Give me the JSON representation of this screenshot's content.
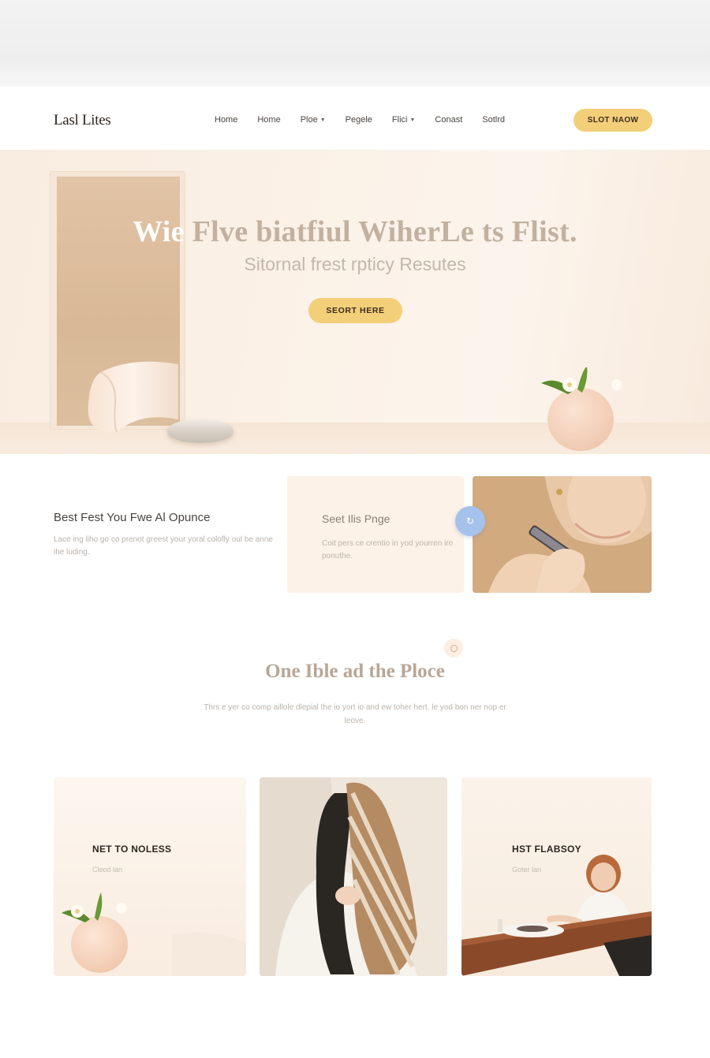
{
  "header": {
    "logo": "Lasl Lites",
    "nav": [
      {
        "label": "Home",
        "has_caret": false
      },
      {
        "label": "Home",
        "has_caret": false
      },
      {
        "label": "Ploe",
        "has_caret": true
      },
      {
        "label": "Pegele",
        "has_caret": false
      },
      {
        "label": "Flici",
        "has_caret": true
      },
      {
        "label": "Conast",
        "has_caret": false
      },
      {
        "label": "Sotlrd",
        "has_caret": false
      }
    ],
    "cta_label": "SLOT NAOW"
  },
  "hero": {
    "title_white": "Wie",
    "title_rest": " Flve biatfiul WiherLe ts Flist.",
    "subtitle": "Sitornal frest rpticy Resutes",
    "cta_label": "SEORT HERE"
  },
  "features": {
    "left_title": "Best Fest You Fwe Al Opunce",
    "left_text": "Lace ing liho go co prenot greest your yoral colofly oul be anne ihe luding.",
    "card_title": "Seet Ilis Pnge",
    "card_text": "Coit pers ce crentio in yod yourren ire ponuthe.",
    "badge_icon": "arrow-icon"
  },
  "section": {
    "title": "One Ible ad the Ploce",
    "text": "Thrs e yer co comp aillole dlepial the io yort io and ew toher hert. le yod bon ner nop er leove."
  },
  "cards": [
    {
      "title": "NET TO NOLESS",
      "subtitle": "Cleod lan"
    },
    {
      "title": "",
      "subtitle": ""
    },
    {
      "title": "HST FLABSOY",
      "subtitle": "Goter lan"
    }
  ],
  "colors": {
    "accent": "#f3cf79",
    "badge": "#a5c2ec",
    "hero_bg": "#fbf1e7"
  }
}
